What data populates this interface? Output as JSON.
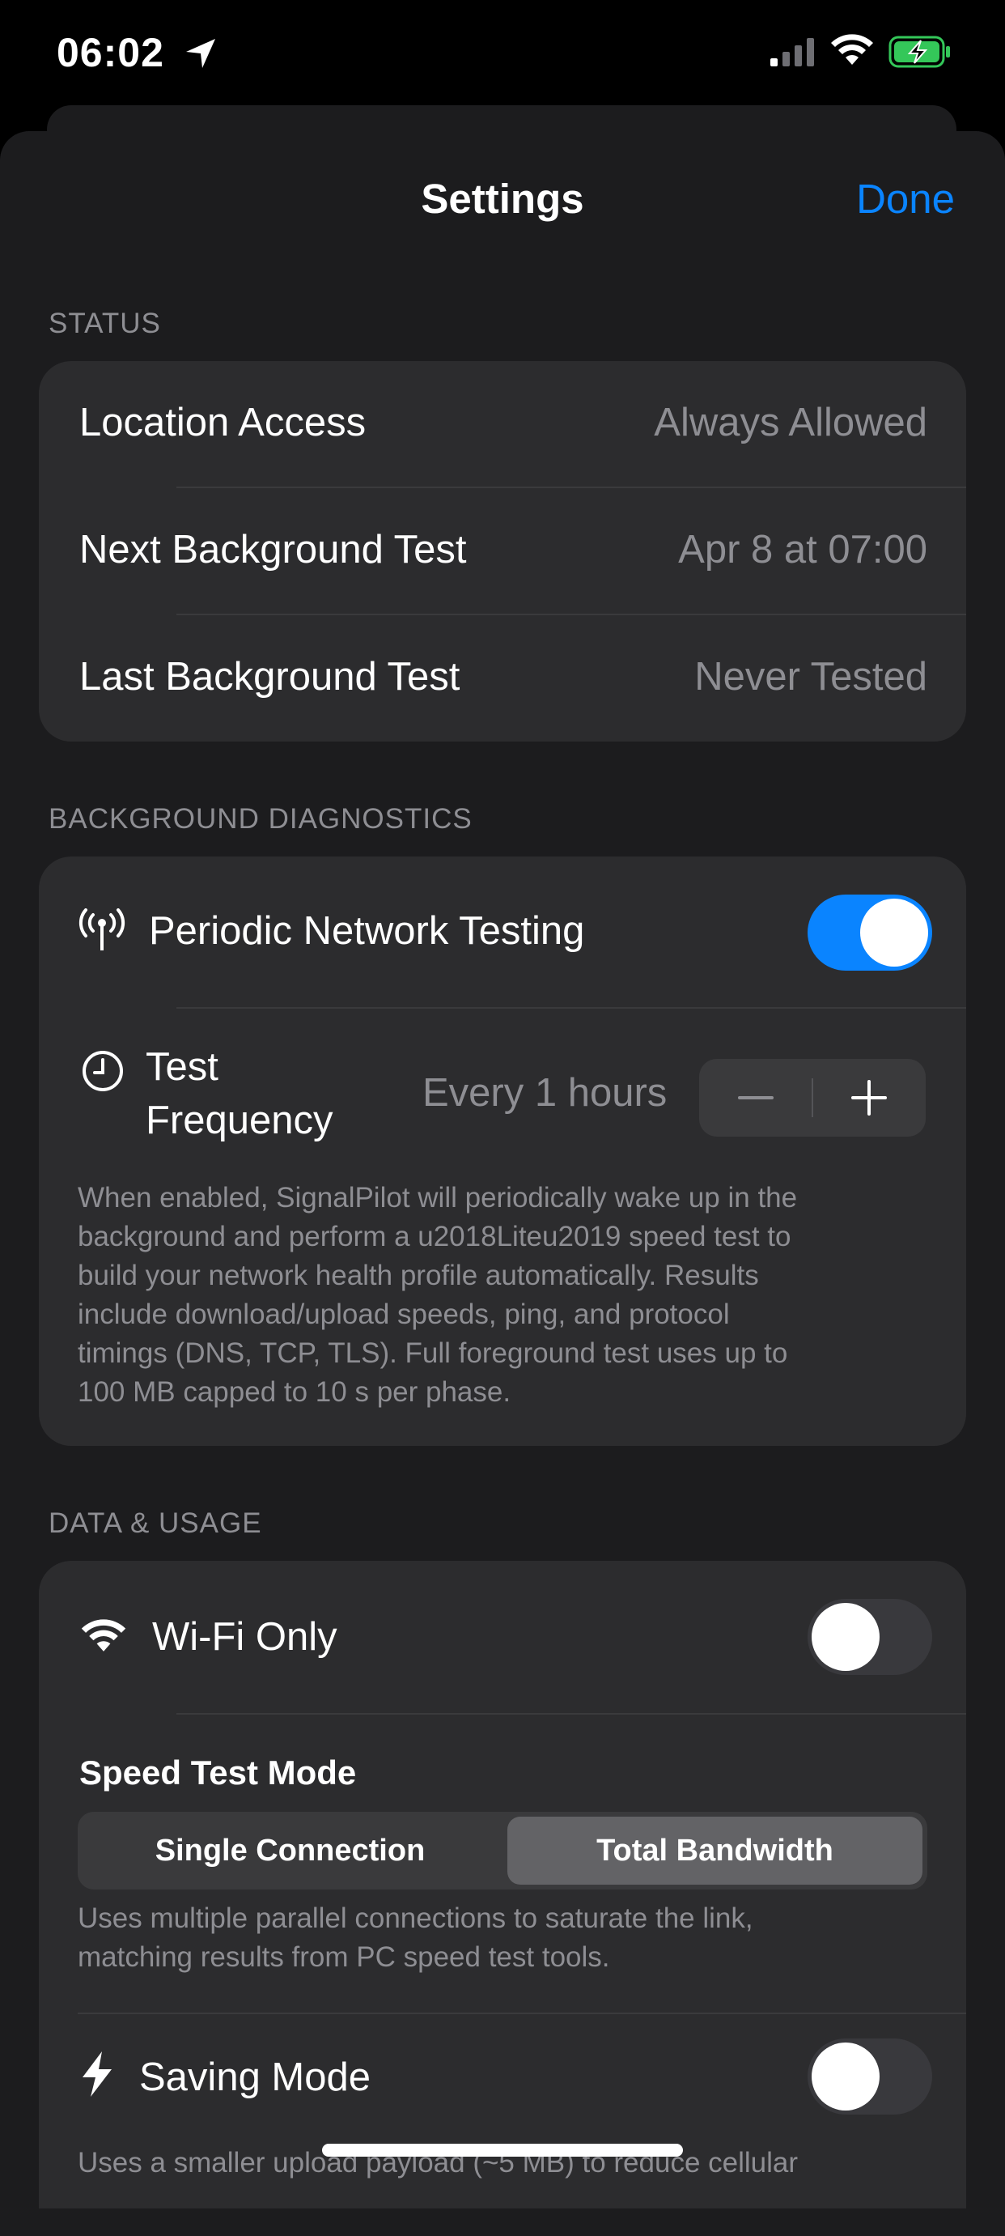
{
  "status_bar": {
    "time": "06:02"
  },
  "nav": {
    "title": "Settings",
    "done_label": "Done"
  },
  "status": {
    "header": "STATUS",
    "rows": [
      {
        "label": "Location Access",
        "value": "Always Allowed"
      },
      {
        "label": "Next Background Test",
        "value": "Apr 8 at 07:00"
      },
      {
        "label": "Last Background Test",
        "value": "Never Tested"
      }
    ]
  },
  "background": {
    "header": "BACKGROUND DIAGNOSTICS",
    "periodic_label": "Periodic Network Testing",
    "periodic_enabled": true,
    "frequency_label_line1": "Test",
    "frequency_label_line2": "Frequency",
    "frequency_value": "Every 1 hours",
    "stepper_minus": "−",
    "stepper_plus": "+",
    "footer_lines": [
      "When enabled, SignalPilot will periodically wake up in the",
      "background and perform a u2018Liteu2019 speed test to",
      "build your network health profile automatically. Results",
      "include download/upload speeds, ping, and protocol",
      "timings (DNS, TCP, TLS). Full foreground test uses up to",
      "100 MB capped to 10 s per phase."
    ]
  },
  "data_usage": {
    "header": "DATA & USAGE",
    "wifi_only_label": "Wi-Fi Only",
    "wifi_only_enabled": false,
    "speed_mode_label": "Speed Test Mode",
    "segments": [
      "Single Connection",
      "Total Bandwidth"
    ],
    "selected_segment": "Total Bandwidth",
    "speed_mode_desc_lines": [
      "Uses multiple parallel connections to saturate the link,",
      "matching results from PC speed test tools."
    ],
    "saving_mode_label": "Saving Mode",
    "saving_mode_enabled": false,
    "saving_mode_desc": "Uses a smaller upload payload (~5 MB) to reduce cellular"
  },
  "colors": {
    "accent": "#0a84ff",
    "background": "#1c1c1e",
    "group": "#2c2c2e"
  },
  "icons": [
    "location-arrow-icon",
    "cellular-signal-icon",
    "wifi-icon",
    "battery-charging-icon",
    "antenna-icon",
    "clock-icon",
    "wifi-icon",
    "bolt-icon"
  ]
}
